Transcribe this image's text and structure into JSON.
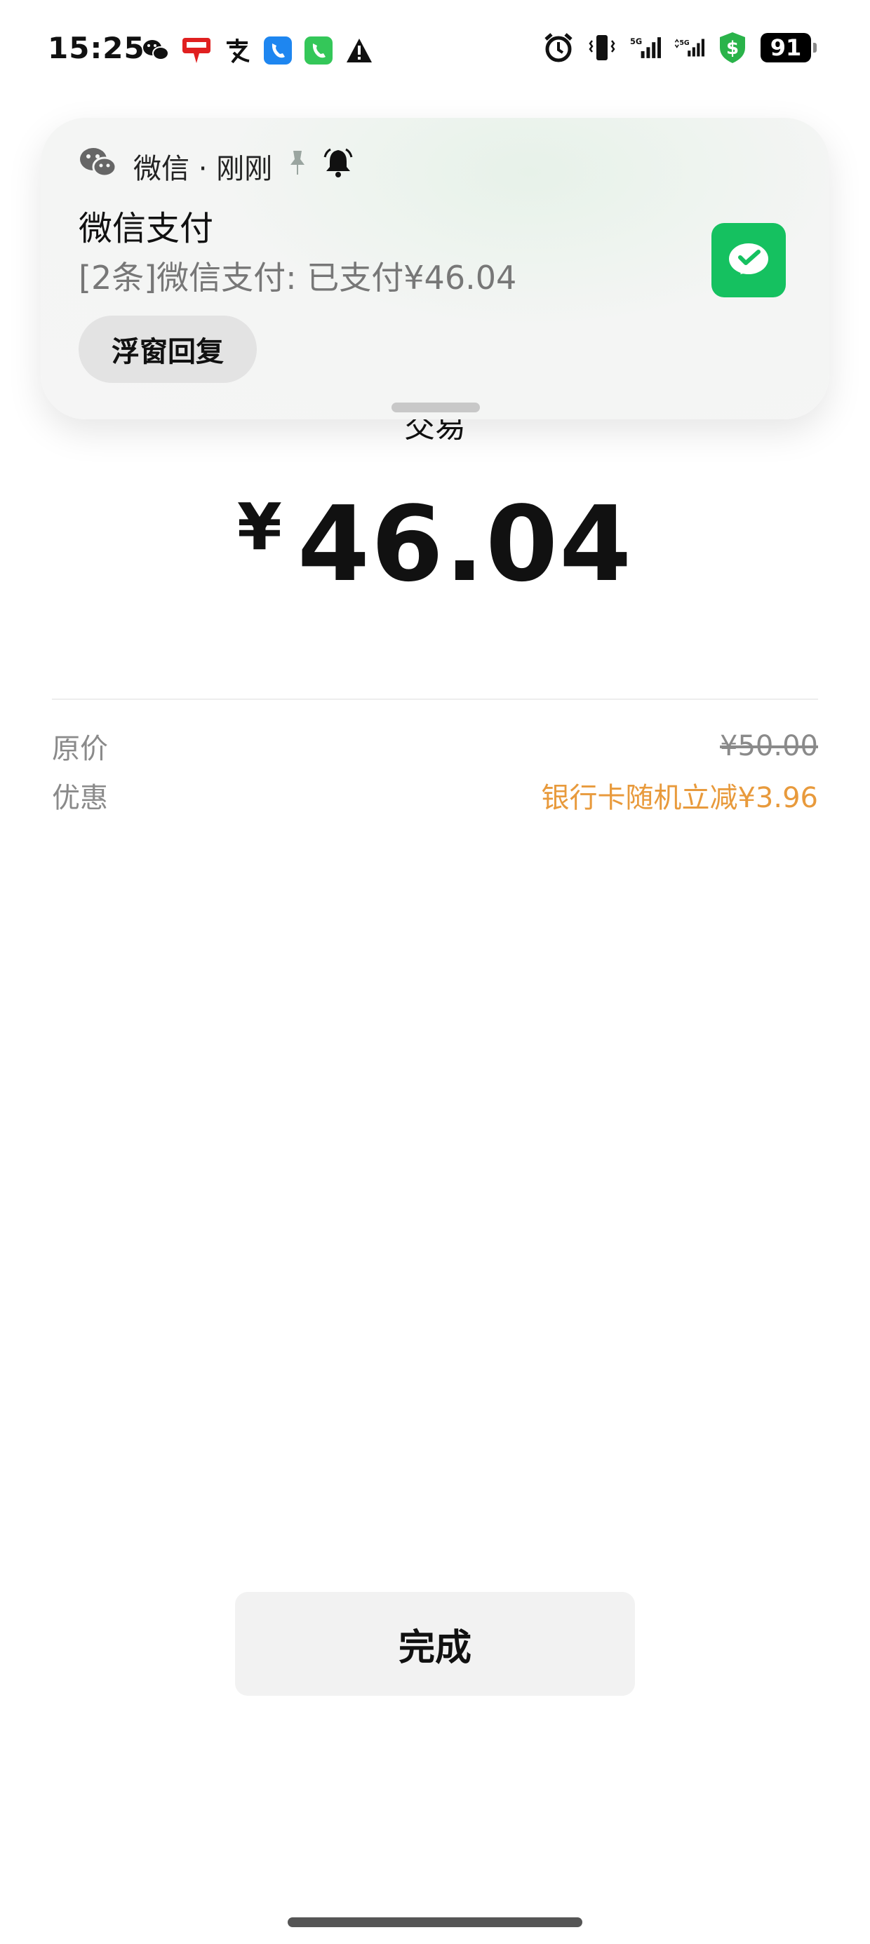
{
  "status_bar": {
    "time": "15:25",
    "left_icons": [
      "wechat-icon",
      "yunshanfu-icon",
      "alipay-icon",
      "phone-blue-icon",
      "phone-green-icon",
      "warning-icon"
    ],
    "right_icons": [
      "alarm-icon",
      "vibrate-icon",
      "signal-5g-icon",
      "signal-5g-icon",
      "security-shield-icon"
    ],
    "battery": "91",
    "signal_label": "5G"
  },
  "notification": {
    "app_name": "微信 · 刚刚",
    "title": "微信支付",
    "body": "[2条]微信支付: 已支付¥46.04",
    "reply_label": "浮窗回复",
    "accent_color": "#15c160"
  },
  "payment": {
    "label": "交易",
    "currency": "¥",
    "amount": "46.04",
    "original_label": "原价",
    "original_value": "¥50.00",
    "discount_label": "优惠",
    "discount_value": "银行卡随机立减¥3.96",
    "discount_color": "#e89a3c"
  },
  "actions": {
    "done_label": "完成"
  }
}
